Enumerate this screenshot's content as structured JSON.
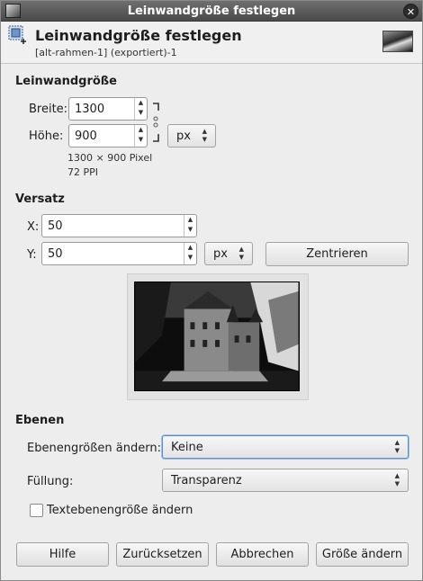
{
  "window": {
    "title": "Leinwandgröße festlegen",
    "close_glyph": "✕"
  },
  "header": {
    "title": "Leinwandgröße festlegen",
    "subtitle": "[alt-rahmen-1] (exportiert)-1"
  },
  "canvas": {
    "section_title": "Leinwandgröße",
    "width_label": "Breite:",
    "width_value": "1300",
    "height_label": "Höhe:",
    "height_value": "900",
    "unit": "px",
    "info_pixels": "1300 × 900 Pixel",
    "info_ppi": "72 PPI"
  },
  "offset": {
    "section_title": "Versatz",
    "x_label": "X:",
    "x_value": "50",
    "y_label": "Y:",
    "y_value": "50",
    "unit": "px",
    "center_button": "Zentrieren"
  },
  "layers": {
    "section_title": "Ebenen",
    "resize_label": "Ebenengrößen ändern:",
    "resize_value": "Keine",
    "fill_label": "Füllung:",
    "fill_value": "Transparenz",
    "resize_text_layers_label": "Textebenengröße ändern",
    "resize_text_layers_checked": false
  },
  "buttons": {
    "help": "Hilfe",
    "reset": "Zurücksetzen",
    "cancel": "Abbrechen",
    "resize": "Größe ändern"
  },
  "icons": {
    "app": "gimp-app-icon",
    "tool": "canvas-size-icon",
    "chain": "chain-link-icon"
  }
}
